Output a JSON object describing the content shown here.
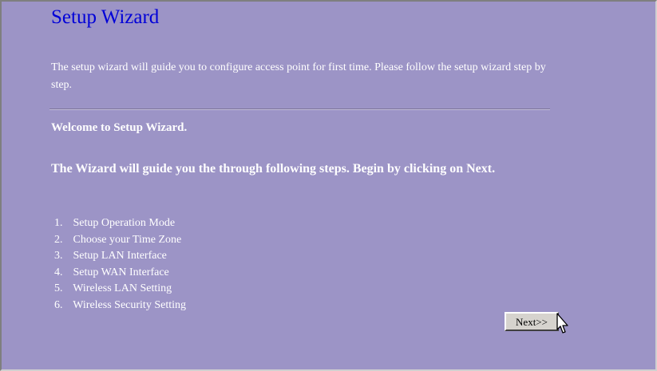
{
  "page": {
    "title": "Setup Wizard",
    "description": "The setup wizard will guide you to configure access point for first time. Please follow the setup wizard step by step.",
    "welcome": "Welcome to Setup Wizard.",
    "guide": "The Wizard will guide you the through following steps. Begin by clicking on Next."
  },
  "steps": [
    {
      "num": "1.",
      "label": "Setup Operation Mode"
    },
    {
      "num": "2.",
      "label": "Choose your Time Zone"
    },
    {
      "num": "3.",
      "label": "Setup LAN Interface"
    },
    {
      "num": "4.",
      "label": "Setup WAN Interface"
    },
    {
      "num": "5.",
      "label": "Wireless LAN Setting"
    },
    {
      "num": "6.",
      "label": "Wireless Security Setting"
    }
  ],
  "buttons": {
    "next_label": "Next>>"
  },
  "colors": {
    "background": "#9c94c6",
    "title": "#0000d8",
    "text": "#ffffff"
  },
  "icons": {
    "cursor": "hand-pointer-cursor-icon"
  }
}
